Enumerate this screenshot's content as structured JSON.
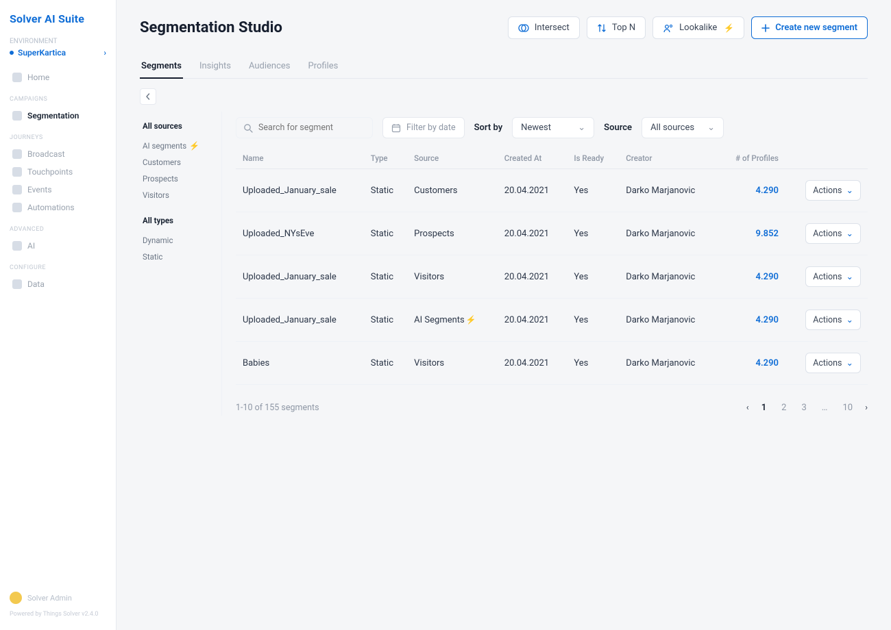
{
  "brand": "Solver AI Suite",
  "sidebar": {
    "env_label": "ENVIRONMENT",
    "env": "SuperKartica",
    "groups": [
      {
        "label": "",
        "items": [
          {
            "name": "home",
            "label": "Home"
          }
        ]
      },
      {
        "label": "CAMPAIGNS",
        "items": [
          {
            "name": "segmentation",
            "label": "Segmentation",
            "active": true
          }
        ]
      },
      {
        "label": "JOURNEYS",
        "items": [
          {
            "name": "broadcast",
            "label": "Broadcast"
          },
          {
            "name": "touchpoints",
            "label": "Touchpoints"
          },
          {
            "name": "events",
            "label": "Events"
          },
          {
            "name": "automations",
            "label": "Automations"
          }
        ]
      },
      {
        "label": "ADVANCED",
        "items": [
          {
            "name": "ai",
            "label": "AI"
          }
        ]
      },
      {
        "label": "CONFIGURE",
        "items": [
          {
            "name": "data",
            "label": "Data"
          }
        ]
      }
    ],
    "user": "Solver Admin",
    "version": "Powered by Things Solver v2.4.0"
  },
  "header": {
    "title": "Segmentation Studio",
    "buttons": {
      "intersect": "Intersect",
      "topn": "Top N",
      "lookalike": "Lookalike",
      "create": "Create new segment"
    }
  },
  "tabs": [
    {
      "id": "segments",
      "label": "Segments",
      "active": true
    },
    {
      "id": "insights",
      "label": "Insights"
    },
    {
      "id": "audiences",
      "label": "Audiences"
    },
    {
      "id": "profiles",
      "label": "Profiles"
    }
  ],
  "filters": {
    "sources_header": "All sources",
    "sources": [
      "AI segments",
      "Customers",
      "Prospects",
      "Visitors"
    ],
    "types_header": "All types",
    "types": [
      "Dynamic",
      "Static"
    ]
  },
  "toolbar": {
    "search_placeholder": "Search for segment",
    "filter_date": "Filter by date",
    "sort_label": "Sort by",
    "sort_value": "Newest",
    "source_label": "Source",
    "source_value": "All sources"
  },
  "table": {
    "columns": [
      "Name",
      "Type",
      "Source",
      "Created At",
      "Is Ready",
      "Creator",
      "# of Profiles",
      ""
    ],
    "rows": [
      {
        "name": "Uploaded_January_sale",
        "type": "Static",
        "source": "Customers",
        "source_bolt": false,
        "created": "20.04.2021",
        "ready": "Yes",
        "creator": "Darko Marjanovic",
        "profiles": "4.290"
      },
      {
        "name": "Uploaded_NYsEve",
        "type": "Static",
        "source": "Prospects",
        "source_bolt": false,
        "created": "20.04.2021",
        "ready": "Yes",
        "creator": "Darko Marjanovic",
        "profiles": "9.852"
      },
      {
        "name": "Uploaded_January_sale",
        "type": "Static",
        "source": "Visitors",
        "source_bolt": false,
        "created": "20.04.2021",
        "ready": "Yes",
        "creator": "Darko Marjanovic",
        "profiles": "4.290"
      },
      {
        "name": "Uploaded_January_sale",
        "type": "Static",
        "source": "AI Segments",
        "source_bolt": true,
        "created": "20.04.2021",
        "ready": "Yes",
        "creator": "Darko Marjanovic",
        "profiles": "4.290"
      },
      {
        "name": "Babies",
        "type": "Static",
        "source": "Visitors",
        "source_bolt": false,
        "created": "20.04.2021",
        "ready": "Yes",
        "creator": "Darko Marjanovic",
        "profiles": "4.290"
      }
    ],
    "action_label": "Actions"
  },
  "footer": {
    "result_count": "1-10 of 155 segments",
    "pages": [
      "1",
      "2",
      "3",
      "…",
      "10"
    ]
  }
}
